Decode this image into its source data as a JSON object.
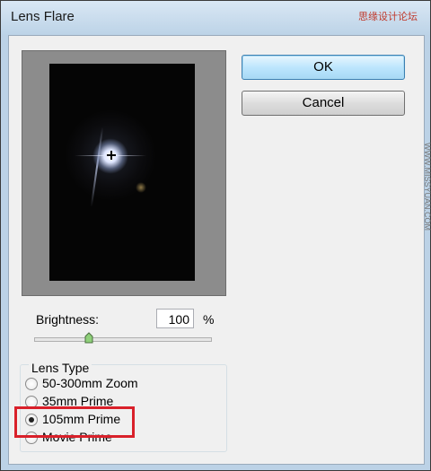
{
  "window": {
    "title": "Lens Flare"
  },
  "watermark": {
    "top": "思缘设计论坛",
    "side": "WWW.MISSYUAN.COM"
  },
  "buttons": {
    "ok": "OK",
    "cancel": "Cancel"
  },
  "brightness": {
    "label": "Brightness:",
    "value": "100",
    "unit": "%",
    "slider_fraction": 0.31
  },
  "lens_type": {
    "title": "Lens Type",
    "options": [
      {
        "label": "50-300mm Zoom",
        "checked": false
      },
      {
        "label": "35mm Prime",
        "checked": false
      },
      {
        "label": "105mm Prime",
        "checked": true
      },
      {
        "label": "Movie Prime",
        "checked": false
      }
    ]
  },
  "colors": {
    "highlight": "#d9202a",
    "ok_button": "#bde6fd"
  }
}
